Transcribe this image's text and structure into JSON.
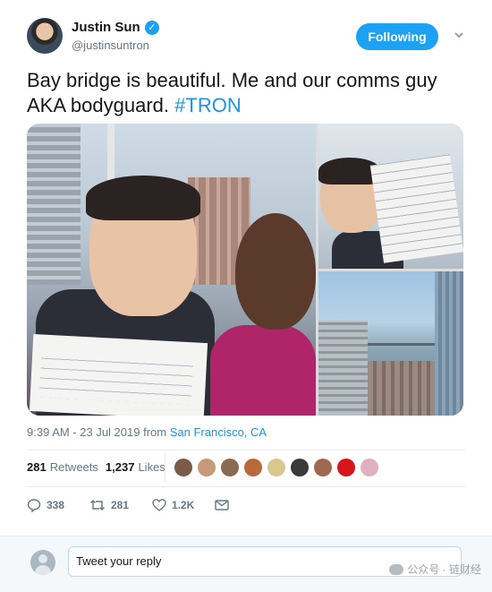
{
  "author": {
    "name": "Justin Sun",
    "handle": "@justinsuntron",
    "verified_glyph": "✓"
  },
  "follow_button": {
    "label": "Following"
  },
  "tweet": {
    "text": "Bay bridge is beautiful. Me and our comms guy AKA bodyguard.",
    "hashtag": "#TRON"
  },
  "meta": {
    "timestamp": "9:39 AM - 23 Jul 2019",
    "from_label": "from",
    "location": "San Francisco, CA"
  },
  "stats": {
    "retweets_count": "281",
    "retweets_label": "Retweets",
    "likes_count": "1,237",
    "likes_label": "Likes"
  },
  "likers": [
    {
      "color": "#7a5a48"
    },
    {
      "color": "#c89a78"
    },
    {
      "color": "#8a6a50"
    },
    {
      "color": "#b86a3a"
    },
    {
      "color": "#d8c890"
    },
    {
      "color": "#3a3a3a"
    },
    {
      "color": "#a06850"
    },
    {
      "color": "#d8141c"
    },
    {
      "color": "#e0b0c0"
    }
  ],
  "actions": {
    "reply_count": "338",
    "retweet_count": "281",
    "like_count": "1.2K"
  },
  "reply_bar": {
    "placeholder": "Tweet your reply",
    "watermark": "公众号 · 链财经"
  },
  "colors": {
    "accent": "#1da1f2",
    "link": "#1b95e0",
    "muted": "#657786"
  }
}
